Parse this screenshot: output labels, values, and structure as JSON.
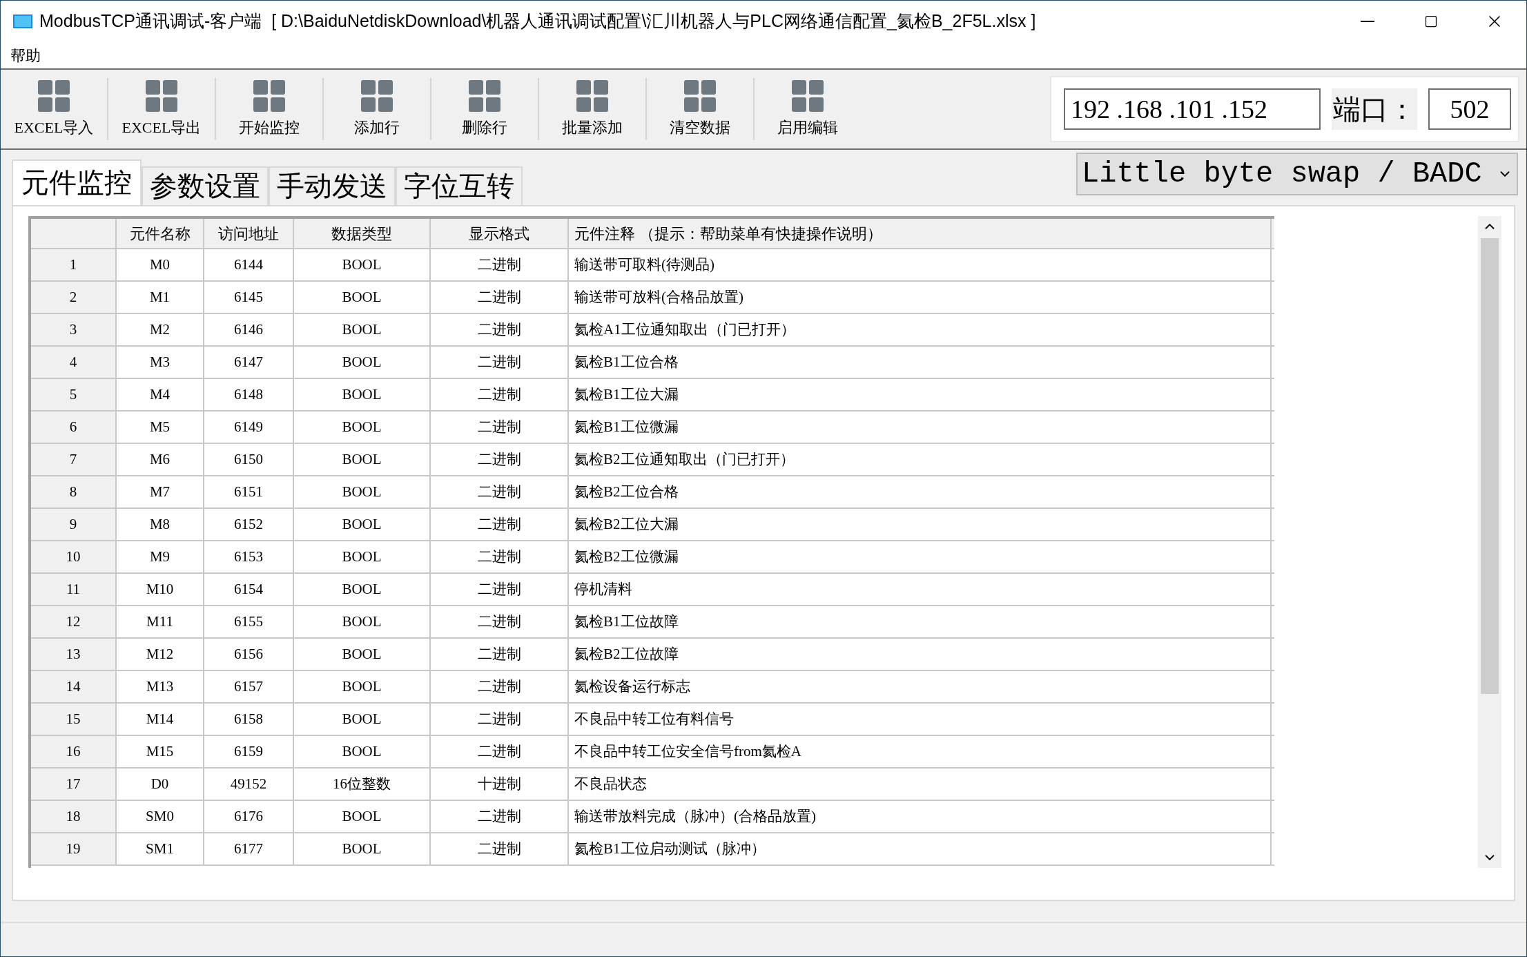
{
  "window": {
    "title": "ModbusTCP通讯调试-客户端  [ D:\\BaiduNetdiskDownload\\机器人通讯调试配置\\汇川机器人与PLC网络通信配置_氦检B_2F5L.xlsx ]"
  },
  "menu": [
    "帮助"
  ],
  "toolbar": [
    "EXCEL导入",
    "EXCEL导出",
    "开始监控",
    "添加行",
    "删除行",
    "批量添加",
    "清空数据",
    "启用编辑"
  ],
  "connection": {
    "ip": "192 .168 .101 .152",
    "port_label": "端口：",
    "port": "502"
  },
  "tabs": [
    {
      "label": "元件监控",
      "selected": true
    },
    {
      "label": "参数设置",
      "selected": false
    },
    {
      "label": "手动发送",
      "selected": false
    },
    {
      "label": "字位互转",
      "selected": false
    }
  ],
  "byte_order": {
    "value": "Little byte swap / BADC"
  },
  "table": {
    "columns": [
      "元件名称",
      "访问地址",
      "数据类型",
      "显示格式",
      "元件注释 （提示：帮助菜单有快捷操作说明）"
    ],
    "rows": [
      {
        "index": "1",
        "cells": [
          "M0",
          "6144",
          "BOOL",
          "二进制",
          "输送带可取料(待测品)"
        ]
      },
      {
        "index": "2",
        "cells": [
          "M1",
          "6145",
          "BOOL",
          "二进制",
          "输送带可放料(合格品放置)"
        ]
      },
      {
        "index": "3",
        "cells": [
          "M2",
          "6146",
          "BOOL",
          "二进制",
          "氦检A1工位通知取出（门已打开）"
        ]
      },
      {
        "index": "4",
        "cells": [
          "M3",
          "6147",
          "BOOL",
          "二进制",
          "氦检B1工位合格"
        ]
      },
      {
        "index": "5",
        "cells": [
          "M4",
          "6148",
          "BOOL",
          "二进制",
          "氦检B1工位大漏"
        ]
      },
      {
        "index": "6",
        "cells": [
          "M5",
          "6149",
          "BOOL",
          "二进制",
          "氦检B1工位微漏"
        ]
      },
      {
        "index": "7",
        "cells": [
          "M6",
          "6150",
          "BOOL",
          "二进制",
          "氦检B2工位通知取出（门已打开）"
        ]
      },
      {
        "index": "8",
        "cells": [
          "M7",
          "6151",
          "BOOL",
          "二进制",
          "氦检B2工位合格"
        ]
      },
      {
        "index": "9",
        "cells": [
          "M8",
          "6152",
          "BOOL",
          "二进制",
          "氦检B2工位大漏"
        ]
      },
      {
        "index": "10",
        "cells": [
          "M9",
          "6153",
          "BOOL",
          "二进制",
          "氦检B2工位微漏"
        ]
      },
      {
        "index": "11",
        "cells": [
          "M10",
          "6154",
          "BOOL",
          "二进制",
          "停机清料"
        ]
      },
      {
        "index": "12",
        "cells": [
          "M11",
          "6155",
          "BOOL",
          "二进制",
          "氦检B1工位故障"
        ]
      },
      {
        "index": "13",
        "cells": [
          "M12",
          "6156",
          "BOOL",
          "二进制",
          "氦检B2工位故障"
        ]
      },
      {
        "index": "14",
        "cells": [
          "M13",
          "6157",
          "BOOL",
          "二进制",
          "氦检设备运行标志"
        ]
      },
      {
        "index": "15",
        "cells": [
          "M14",
          "6158",
          "BOOL",
          "二进制",
          "不良品中转工位有料信号"
        ]
      },
      {
        "index": "16",
        "cells": [
          "M15",
          "6159",
          "BOOL",
          "二进制",
          "不良品中转工位安全信号from氦检A"
        ]
      },
      {
        "index": "17",
        "cells": [
          "D0",
          "49152",
          "16位整数",
          "十进制",
          "不良品状态"
        ]
      },
      {
        "index": "18",
        "cells": [
          "SM0",
          "6176",
          "BOOL",
          "二进制",
          "输送带放料完成（脉冲）(合格品放置)"
        ]
      },
      {
        "index": "19",
        "cells": [
          "SM1",
          "6177",
          "BOOL",
          "二进制",
          "氦检B1工位启动测试（脉冲）"
        ]
      }
    ]
  }
}
